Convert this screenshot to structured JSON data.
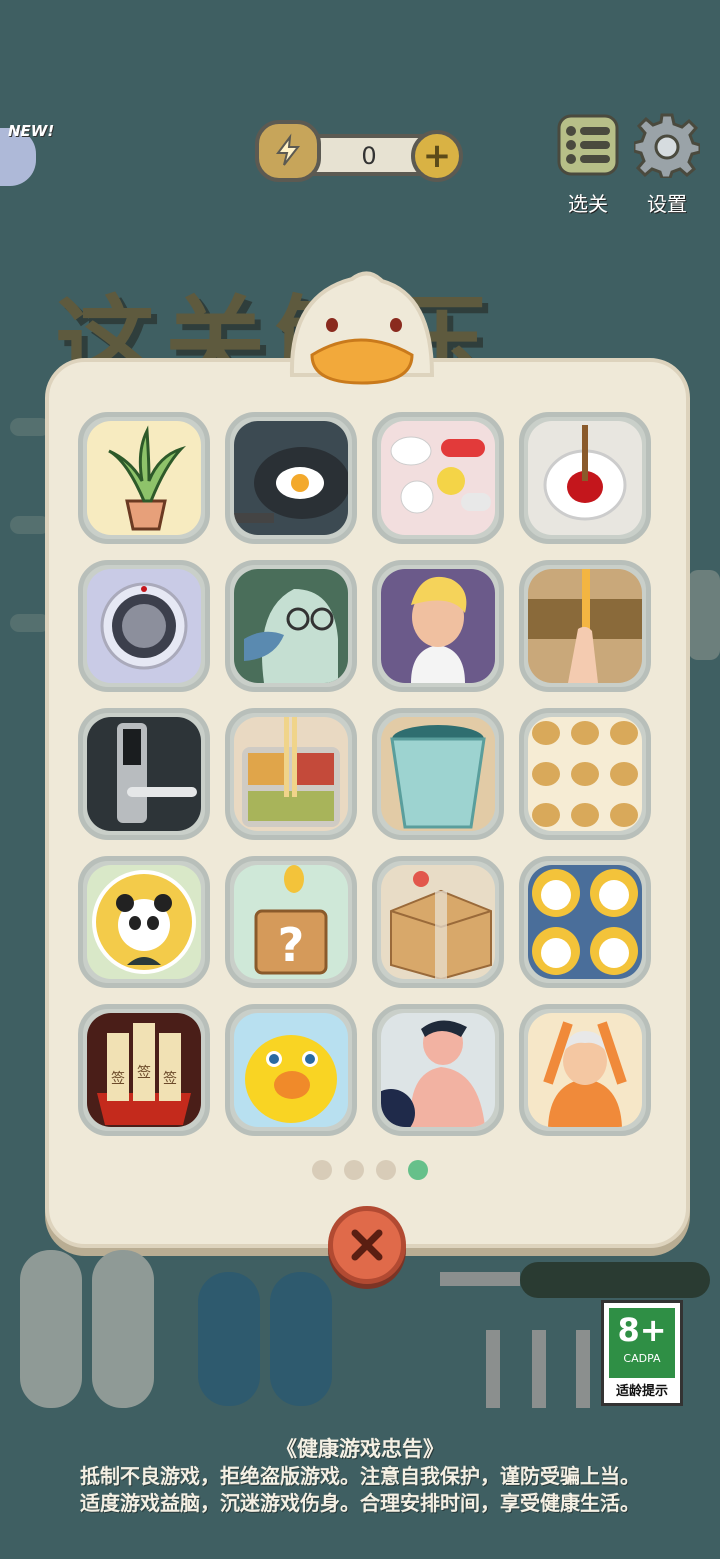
{
  "background": {
    "title_text": "这关解压"
  },
  "topbar": {
    "coin_count": "0",
    "level_select_label": "选关",
    "settings_label": "设置",
    "new_tag": "NEW!"
  },
  "levels": [
    {
      "name": "potted plant"
    },
    {
      "name": "frying egg"
    },
    {
      "name": "pills"
    },
    {
      "name": "toilet plunger"
    },
    {
      "name": "safe dial"
    },
    {
      "name": "bird with glasses"
    },
    {
      "name": "blond man"
    },
    {
      "name": "pencil finger"
    },
    {
      "name": "door lock"
    },
    {
      "name": "bento box"
    },
    {
      "name": "trash can"
    },
    {
      "name": "hamster pattern"
    },
    {
      "name": "panda plate"
    },
    {
      "name": "question block"
    },
    {
      "name": "cardboard box"
    },
    {
      "name": "panda pattern"
    },
    {
      "name": "fortune sticks",
      "text": "签"
    },
    {
      "name": "rubber duck"
    },
    {
      "name": "muscle man"
    },
    {
      "name": "grandma stretching"
    }
  ],
  "pagination": {
    "pages": 4,
    "current": 4
  },
  "age_rating": {
    "value": "8+",
    "org": "CADPA",
    "label": "适龄提示"
  },
  "advisory": {
    "title": "《健康游戏忠告》",
    "line1": "抵制不良游戏，拒绝盗版游戏。注意自我保护，谨防受骗上当。",
    "line2": "适度游戏益脑，沉迷游戏伤身。合理安排时间，享受健康生活。"
  },
  "colors": {
    "background": "#3f5f62",
    "modal": "#efe9d8",
    "active_dot": "#66c08a",
    "close_button": "#e06a4a"
  }
}
